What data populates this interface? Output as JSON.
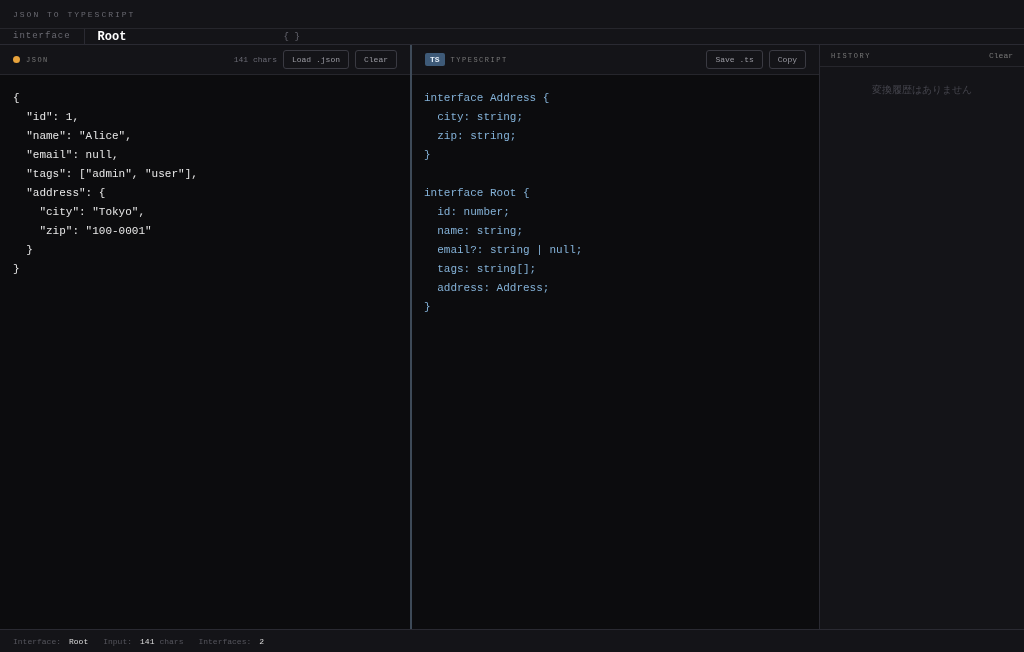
{
  "app_title": "JSON TO TYPESCRIPT",
  "interface_bar": {
    "label": "interface",
    "value": "Root",
    "hint": "{ }"
  },
  "json_panel": {
    "title": "JSON",
    "char_count": "141 chars",
    "buttons": [
      "Load .json",
      "Clear"
    ],
    "lines": [
      "{",
      "  \"id\": 1,",
      "  \"name\": \"Alice\",",
      "  \"email\": null,",
      "  \"tags\": [\"admin\", \"user\"],",
      "  \"address\": {",
      "    \"city\": \"Tokyo\",",
      "    \"zip\": \"100-0001\"",
      "  }",
      "}"
    ]
  },
  "ts_panel": {
    "badge": "TS",
    "title": "TYPESCRIPT",
    "buttons": [
      "Save .ts",
      "Copy"
    ],
    "blocks": [
      [
        "interface Address {",
        "  city: string;",
        "  zip: string;",
        "}"
      ],
      [
        "interface Root {",
        "  id: number;",
        "  name: string;",
        "  email?: string | null;",
        "  tags: string[];",
        "  address: Address;",
        "}"
      ]
    ]
  },
  "history": {
    "title": "HISTORY",
    "clear": "Clear",
    "empty_message": "変換履歴はありません"
  },
  "status_bar": [
    {
      "label": "Interface:",
      "value": "Root"
    },
    {
      "label": "Input:",
      "value": "141",
      "unit": "chars"
    },
    {
      "label": "Interfaces:",
      "value": "2"
    }
  ]
}
